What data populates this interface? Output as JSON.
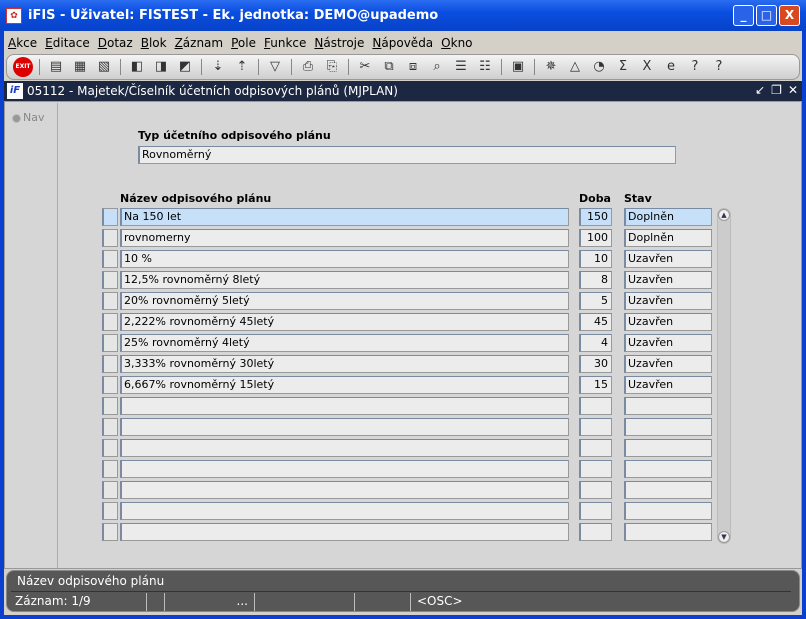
{
  "window": {
    "title": "iFIS - Uživatel: FISTEST - Ek. jednotka: DEMO@upademo",
    "minimize": "_",
    "maximize": "□",
    "close": "X"
  },
  "menu": [
    "Akce",
    "Editace",
    "Dotaz",
    "Blok",
    "Záznam",
    "Pole",
    "Funkce",
    "Nástroje",
    "Nápověda",
    "Okno"
  ],
  "toolbar": {
    "exit_label": "EXIT",
    "icons": [
      "add-record",
      "save-record",
      "delete-record",
      "query-enter",
      "query-execute",
      "query-cancel",
      "sort-asc",
      "sort-desc",
      "filter",
      "print",
      "print-preview",
      "cut",
      "copy",
      "paste",
      "find",
      "list",
      "tree",
      "calendar",
      "settings",
      "triangle",
      "clock",
      "sum",
      "excel",
      "internet-explorer",
      "help",
      "context-help"
    ]
  },
  "form": {
    "title": "05112 - Majetek/Číselník účetních odpisových plánů (MJPLAN)",
    "nav_label": "Nav",
    "type_label": "Typ účetního odpisového plánu",
    "type_value": "Rovnoměrný",
    "columns": {
      "name": "Název odpisového plánu",
      "doba": "Doba",
      "stav": "Stav"
    },
    "rows": [
      {
        "name": "Na 150 let",
        "doba": "150",
        "stav": "Doplněn"
      },
      {
        "name": "rovnomerny",
        "doba": "100",
        "stav": "Doplněn"
      },
      {
        "name": "10 %",
        "doba": "10",
        "stav": "Uzavřen"
      },
      {
        "name": "12,5% rovnoměrný 8letý",
        "doba": "8",
        "stav": "Uzavřen"
      },
      {
        "name": "20% rovnoměrný 5letý",
        "doba": "5",
        "stav": "Uzavřen"
      },
      {
        "name": "2,222% rovnoměrný 45letý",
        "doba": "45",
        "stav": "Uzavřen"
      },
      {
        "name": "25% rovnoměrný 4letý",
        "doba": "4",
        "stav": "Uzavřen"
      },
      {
        "name": "3,333% rovnoměrný 30letý",
        "doba": "30",
        "stav": "Uzavřen"
      },
      {
        "name": "6,667% rovnoměrný 15letý",
        "doba": "15",
        "stav": "Uzavřen"
      }
    ],
    "empty_rows": 7
  },
  "status": {
    "hint": "Název odpisového plánu",
    "record": "Záznam: 1/9",
    "dots": "...",
    "mode": "<OSC>"
  }
}
